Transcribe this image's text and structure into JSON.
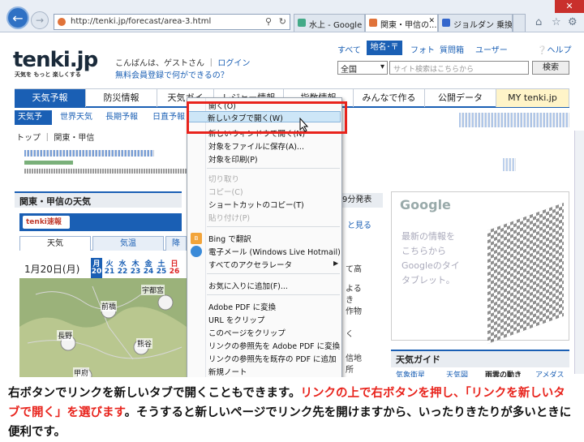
{
  "browser": {
    "url": "http://tenki.jp/forecast/area-3.html",
    "tabs": [
      {
        "label": "水上 - Google ...",
        "active": false
      },
      {
        "label": "関東・甲信の...",
        "active": true
      },
      {
        "label": "ジョルダン 乗換...",
        "active": false
      }
    ],
    "close_label": "✕"
  },
  "site": {
    "logo": "tenki.jp",
    "tagline": "天気を もっと 楽しくする",
    "greeting": "こんばんは、ゲストさん",
    "login": "ログイン",
    "register": "無料会員登録で何ができるの？",
    "top_links": [
      "すべて",
      "地名･〒",
      "フォト",
      "質問箱",
      "ユーザー"
    ],
    "help": "ヘルプ",
    "search_select": "全国",
    "search_placeholder": "サイト検索はこちらから",
    "search_button": "検索"
  },
  "nav": {
    "items": [
      "天気予報",
      "防災情報",
      "天気ガイ",
      "レジャー情報",
      "指数情報",
      "みんなで作る",
      "公開データ",
      "MY tenki.jp"
    ]
  },
  "subnav": {
    "items": [
      "天気予報",
      "世界天気",
      "長期予報",
      "日直予報"
    ]
  },
  "breadcrumb": "トップ ｜ 関東・甲信",
  "section": {
    "title": "関東・甲信の天気",
    "right_label": "9分発表",
    "flash_badge": "tenki速報",
    "flash_link": "と見る",
    "tabs": [
      "天気",
      "気温",
      "降"
    ],
    "date": "1月20日(月)",
    "weekdays": [
      "月",
      "火",
      "水",
      "木",
      "金",
      "土",
      "日"
    ],
    "daynums": [
      "20",
      "21",
      "22",
      "23",
      "24",
      "25",
      "26"
    ],
    "cities": [
      "宇都宮",
      "前橋",
      "長野",
      "熊谷",
      "甲府"
    ],
    "side_texts": [
      "て高",
      "よる",
      "き",
      "作物",
      "く",
      "信地",
      "所"
    ]
  },
  "ad": {
    "brand": "Google",
    "lines": [
      "最新の情報を",
      "こちらから",
      "Googleのタイ",
      "タブレット。"
    ]
  },
  "guide": {
    "title": "天気ガイド",
    "tabs": [
      "気象衛星",
      "天気図",
      "雨雲の動き",
      "アメダス"
    ]
  },
  "context_menu": {
    "items": [
      {
        "label": "開く(O)",
        "disabled": false
      },
      {
        "label": "新しいタブで開く(W)",
        "disabled": false,
        "highlighted": true
      },
      {
        "label": "新しいウィンドウで開く(N)",
        "disabled": false
      },
      {
        "label": "対象をファイルに保存(A)...",
        "disabled": false
      },
      {
        "label": "対象を印刷(P)",
        "disabled": false
      },
      {
        "label": "切り取り",
        "disabled": true
      },
      {
        "label": "コピー(C)",
        "disabled": true
      },
      {
        "label": "ショートカットのコピー(T)",
        "disabled": false
      },
      {
        "label": "貼り付け(P)",
        "disabled": true
      },
      {
        "label": "Bing で翻訳",
        "disabled": false
      },
      {
        "label": "電子メール (Windows Live Hotmail)",
        "disabled": false
      },
      {
        "label": "すべてのアクセラレータ",
        "disabled": false
      },
      {
        "label": "お気に入りに追加(F)...",
        "disabled": false
      },
      {
        "label": "Adobe PDF に変換",
        "disabled": false
      },
      {
        "label": "URL をクリップ",
        "disabled": false
      },
      {
        "label": "このページをクリップ",
        "disabled": false
      },
      {
        "label": "リンクの参照先を Adobe PDF に変換",
        "disabled": false
      },
      {
        "label": "リンクの参照先を既存の PDF に追加",
        "disabled": false
      },
      {
        "label": "新規ノート",
        "disabled": false
      }
    ]
  },
  "caption": {
    "part1": "右ボタンでリンクを新しいタブで開くこともできます。",
    "part2": "リンクの上で右ボタンを押し、「リンクを新しいタブで開く」を選びます",
    "part3": "。そうすると新しいページでリンク先を開けますから、いったりきたりが多いときに便利です。"
  },
  "colors": {
    "accent": "#1a5fb4",
    "highlight_red": "#e8231c"
  }
}
